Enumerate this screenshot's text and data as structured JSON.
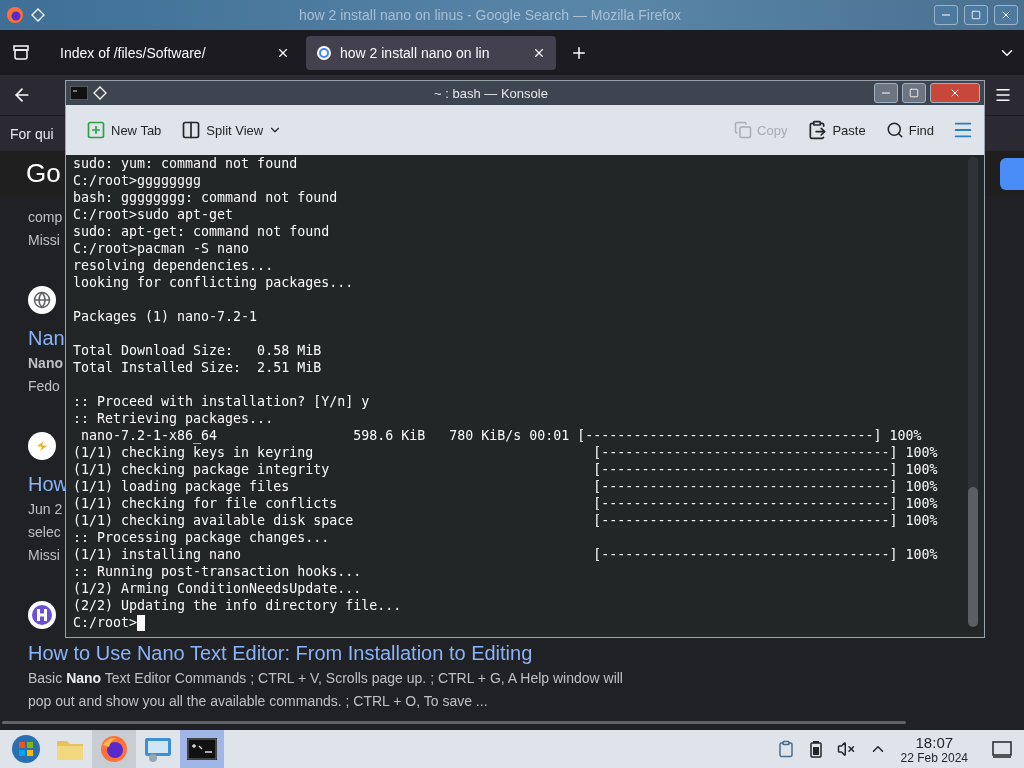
{
  "firefox": {
    "title": "how 2 install nano on linus - Google Search — Mozilla Firefox",
    "tabs": [
      {
        "label": "Index of /files/Software/",
        "selected": false
      },
      {
        "label": "how 2 install nano on lin",
        "selected": true
      }
    ],
    "banner": "For qui",
    "logo": "Go",
    "results": [
      {
        "lines": [
          {
            "text": "comp",
            "bold": false
          },
          {
            "text": "Missi",
            "bold": false
          }
        ]
      },
      {
        "title": "Nan",
        "lines": [
          {
            "text": "Nano",
            "bold": true
          },
          {
            "text": "Fedo",
            "bold": false
          }
        ]
      },
      {
        "title": "How",
        "lines": [
          {
            "text": "Jun 2",
            "bold": false
          },
          {
            "text": "selec",
            "bold": false
          },
          {
            "text": "Missi",
            "bold": false
          }
        ]
      },
      {
        "title": "How to Use Nano Text Editor: From Installation to Editing",
        "lines": [
          {
            "text": "Basic **Nano** Text Editor Commands ; CTRL + V, Scrolls page up. ; CTRL + G, A Help window will",
            "bold": false
          },
          {
            "text": "pop out and show you all the available commands. ; CTRL + O, To save ...",
            "bold": false
          }
        ]
      }
    ]
  },
  "konsole": {
    "title": "~ : bash — Konsole",
    "toolbar_left": [
      {
        "label": "New Tab",
        "kind": "newtab",
        "disabled": false
      },
      {
        "label": "Split View",
        "kind": "split",
        "disabled": false
      }
    ],
    "toolbar_right": [
      {
        "label": "Copy",
        "kind": "copy",
        "disabled": true
      },
      {
        "label": "Paste",
        "kind": "paste",
        "disabled": false
      },
      {
        "label": "Find",
        "kind": "find",
        "disabled": false
      }
    ],
    "cursor": true,
    "blocks": [
      [
        "sudo: yum: command not found",
        "C:/root>gggggggg",
        "bash: gggggggg: command not found",
        "C:/root>sudo apt-get",
        "sudo: apt-get: command not found",
        "C:/root>pacman -S nano",
        "resolving dependencies...",
        "looking for conflicting packages..."
      ],
      [
        "Packages (1) nano-7.2-1"
      ],
      [
        "Total Download Size:   0.58 MiB",
        "Total Installed Size:  2.51 MiB"
      ],
      [
        ":: Proceed with installation? [Y/n] y",
        ":: Retrieving packages...",
        " nano-7.2-1-x86_64                 598.6 KiB   780 KiB/s 00:01 [------------------------------------] 100%",
        "(1/1) checking keys in keyring                                   [------------------------------------] 100%",
        "(1/1) checking package integrity                                 [------------------------------------] 100%",
        "(1/1) loading package files                                      [------------------------------------] 100%",
        "(1/1) checking for file conflicts                                [------------------------------------] 100%",
        "(1/1) checking available disk space                              [------------------------------------] 100%",
        ":: Processing package changes...",
        "(1/1) installing nano                                            [------------------------------------] 100%",
        ":: Running post-transaction hooks...",
        "(1/2) Arming ConditionNeedsUpdate...",
        "(2/2) Updating the info directory file...",
        "C:/root>"
      ]
    ]
  },
  "taskbar": {
    "items": [
      {
        "kind": "start",
        "open": false,
        "selected": false
      },
      {
        "kind": "files",
        "open": false,
        "selected": false
      },
      {
        "kind": "firefox",
        "open": true,
        "selected": false
      },
      {
        "kind": "monitor",
        "open": false,
        "selected": false
      },
      {
        "kind": "terminal",
        "open": true,
        "selected": true
      }
    ],
    "time": "18:07",
    "date": "22 Feb 2024"
  }
}
